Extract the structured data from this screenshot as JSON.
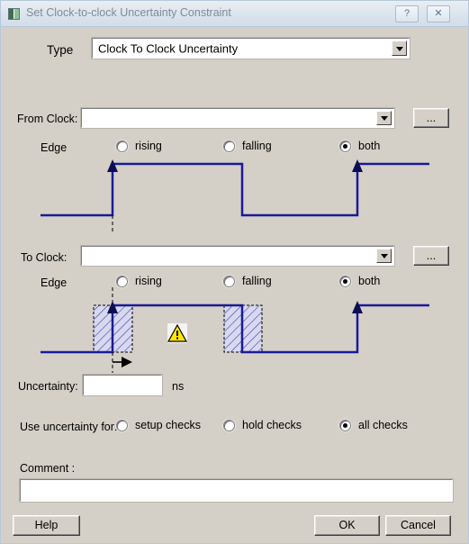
{
  "window": {
    "title": "Set Clock-to-clock Uncertainty Constraint",
    "icon": "app-icon",
    "help_button": "?",
    "close_button": "✕"
  },
  "type_row": {
    "label": "Type",
    "value": "Clock To Clock Uncertainty",
    "arrow_icon": "chevron-down-icon"
  },
  "from_clock": {
    "label": "From Clock:",
    "value": "",
    "browse_label": "...",
    "edge_label": "Edge",
    "edges": [
      {
        "label": "rising",
        "selected": false
      },
      {
        "label": "falling",
        "selected": false
      },
      {
        "label": "both",
        "selected": true
      }
    ]
  },
  "to_clock": {
    "label": "To Clock:",
    "value": "",
    "browse_label": "...",
    "edge_label": "Edge",
    "edges": [
      {
        "label": "rising",
        "selected": false
      },
      {
        "label": "falling",
        "selected": false
      },
      {
        "label": "both",
        "selected": true
      }
    ],
    "warning_icon": "warning-triangle-icon"
  },
  "uncertainty": {
    "label": "Uncertainty:",
    "value": "",
    "unit": "ns"
  },
  "use_for": {
    "label": "Use uncertainty for:",
    "options": [
      {
        "label": "setup checks",
        "selected": false
      },
      {
        "label": "hold checks",
        "selected": false
      },
      {
        "label": "all checks",
        "selected": true
      }
    ]
  },
  "comment": {
    "label": "Comment :",
    "value": ""
  },
  "buttons": {
    "help": "Help",
    "ok": "OK",
    "cancel": "Cancel"
  },
  "colors": {
    "dialog_bg": "#d4d0c8",
    "waveform": "#1a1a99",
    "hatch": "#3333aa",
    "warning_fill": "#ffe800",
    "title_text": "#7e8c9a"
  }
}
